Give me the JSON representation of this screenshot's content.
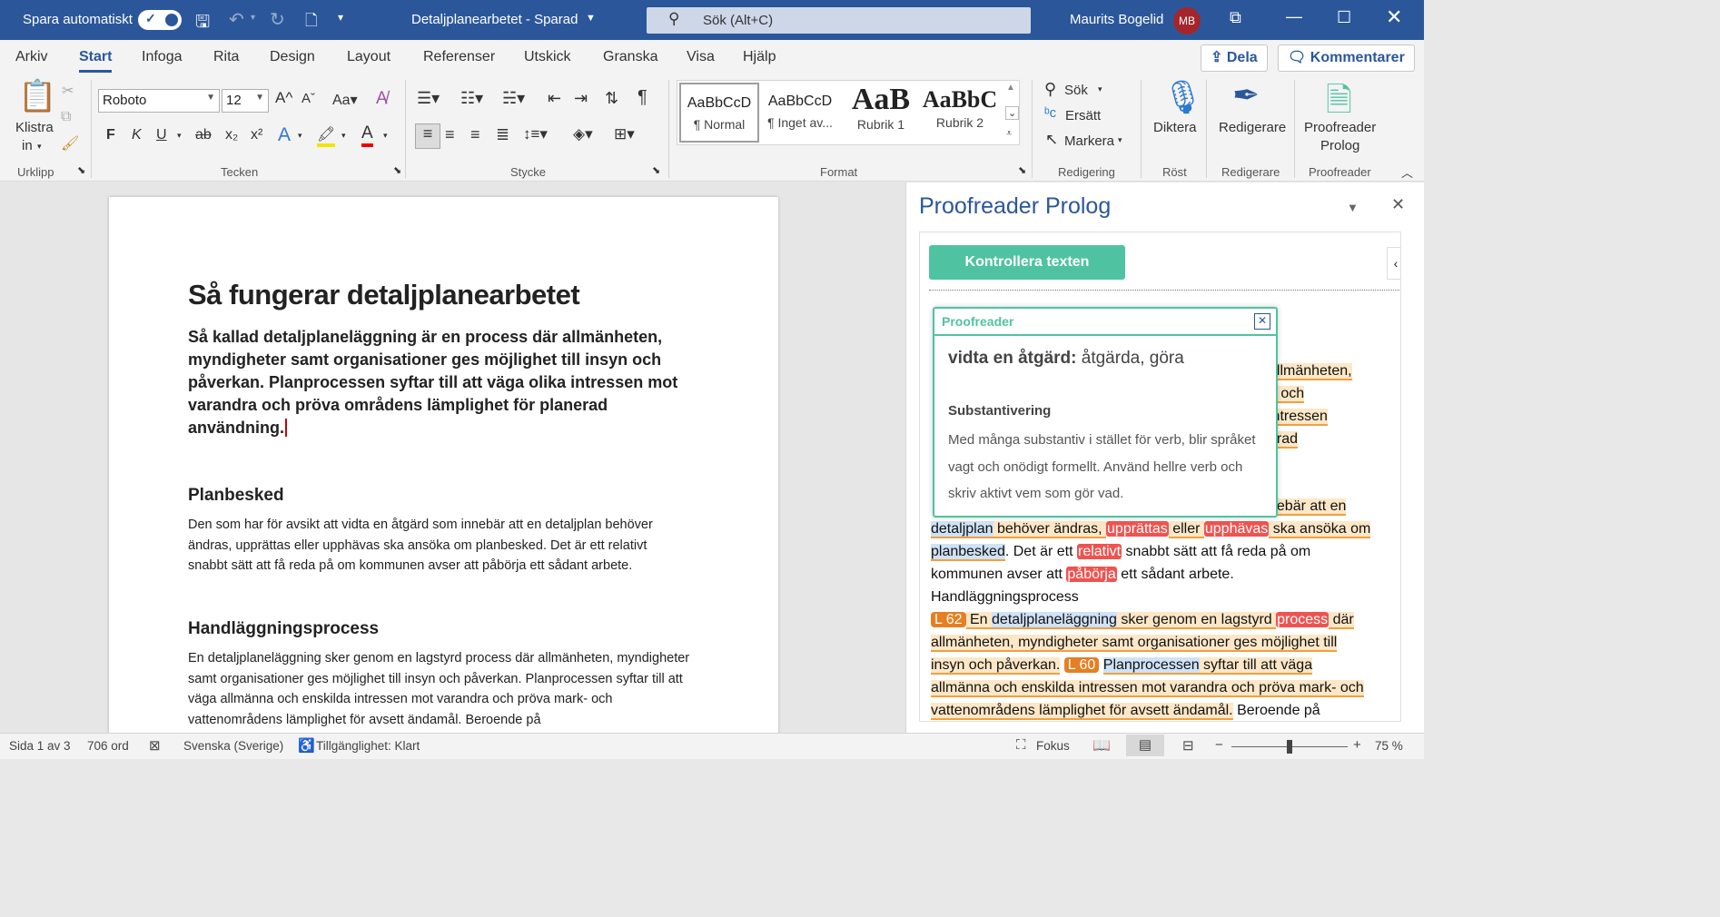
{
  "titlebar": {
    "autosave_label": "Spara automatiskt",
    "doc_title": "Detaljplanearbetet  -  Sparad",
    "search_placeholder": "Sök (Alt+C)",
    "user_name": "Maurits Bogelid",
    "user_initials": "MB"
  },
  "menu": {
    "tabs": [
      "Arkiv",
      "Start",
      "Infoga",
      "Rita",
      "Design",
      "Layout",
      "Referenser",
      "Utskick",
      "Granska",
      "Visa",
      "Hjälp"
    ],
    "active": "Start",
    "share_label": "Dela",
    "comments_label": "Kommentarer"
  },
  "ribbon": {
    "clipboard": {
      "paste_label1": "Klistra",
      "paste_label2": "in",
      "group": "Urklipp"
    },
    "font": {
      "name": "Roboto",
      "size": "12",
      "group": "Tecken",
      "bold": "F",
      "italic": "K",
      "underline": "U"
    },
    "paragraph": {
      "group": "Stycke"
    },
    "styles": {
      "group": "Format",
      "items": [
        {
          "preview": "AaBbCcD",
          "name": "¶ Normal"
        },
        {
          "preview": "AaBbCcD",
          "name": "¶ Inget av..."
        },
        {
          "preview": "AaB",
          "name": "Rubrik 1"
        },
        {
          "preview": "AaBbC",
          "name": "Rubrik 2"
        }
      ]
    },
    "editing": {
      "find": "Sök",
      "replace": "Ersätt",
      "select": "Markera",
      "group": "Redigering"
    },
    "voice": {
      "dictate": "Diktera",
      "group": "Röst"
    },
    "editor": {
      "label": "Redigerare",
      "group": "Redigerare"
    },
    "proofreader": {
      "label1": "Proofreader",
      "label2": "Prolog",
      "group": "Proofreader"
    }
  },
  "document": {
    "title": "Så fungerar detaljplanearbetet",
    "lead": "Så kallad detaljplaneläggning är en process där allmänheten, myndigheter samt organisationer ges möjlighet till insyn och påverkan. Planprocessen syftar till att väga olika intressen mot varandra och pröva områdens lämplighet för planerad användning.",
    "h_planbesked": "Planbesked",
    "p_planbesked": "Den som har för avsikt att vidta en åtgärd som innebär att en detaljplan behöver ändras, upprättas eller upphävas ska ansöka om planbesked. Det är ett relativt snabbt sätt att få reda på om kommunen avser att påbörja ett sådant arbete.",
    "h_process": "Handläggningsprocess",
    "p_process": "En detaljplaneläggning sker genom en lagstyrd process där allmänheten, myndigheter samt organisationer ges möjlighet till insyn och påverkan. Planprocessen syftar till att väga allmänna och enskilda intressen mot varandra och pröva mark- och vattenområdens lämplighet för avsett ändamål. Beroende på"
  },
  "pane": {
    "title": "Proofreader Prolog",
    "check_button": "Kontrollera texten",
    "popup": {
      "header": "Proofreader",
      "term": "vidta en åtgärd:",
      "suggestion": "åtgärda, göra",
      "category": "Substantivering",
      "explanation": "Med många substantiv i stället för verb, blir språket vagt och onödigt formellt. Använd hellre verb och skriv aktivt vem som gör vad."
    },
    "frag": {
      "r1": "allmänheten,",
      "r2": "n och",
      "r3": "intressen",
      "r4": "erad",
      "s1": "nebär att en",
      "s2a": "detaljplan",
      "s2b": " behöver ändras, ",
      "s2c": "upprättas",
      "s2d": " eller ",
      "s2e": "upphävas",
      "s2f": " ska ansöka om",
      "s3a": "planbesked",
      "s3b": ". Det är ett ",
      "s3c": "relativt",
      "s3d": " snabbt sätt att få reda på om",
      "s4a": "kommunen avser att ",
      "s4b": "påbörja",
      "s4c": " ett sådant arbete.",
      "s5": "Handläggningsprocess",
      "t1": "L 62",
      "s6a": " En ",
      "s6b": "detaljplaneläggning",
      "s6c": " sker genom en lagstyrd ",
      "s6d": "process",
      "s6e": " där",
      "s7": "allmänheten, myndigheter samt organisationer ges möjlighet till",
      "s8a": "insyn och påverkan.",
      "t2": "L 60",
      "s8b": "Planprocessen",
      "s8c": " syftar till att väga",
      "s9": "allmänna och enskilda intressen mot varandra och pröva mark- och",
      "s10a": "vattenområdens lämplighet för avsett ändamål.",
      "s10b": " Beroende på"
    }
  },
  "status": {
    "page": "Sida 1 av 3",
    "words": "706 ord",
    "language": "Svenska (Sverige)",
    "accessibility": "Tillgänglighet: Klart",
    "focus": "Fokus",
    "zoom": "75 %",
    "zoom_fraction": 0.5
  },
  "colors": {
    "brand": "#2b579a",
    "accent": "#4fc3a1",
    "error": "#ef5350",
    "tag": "#e67e22"
  }
}
